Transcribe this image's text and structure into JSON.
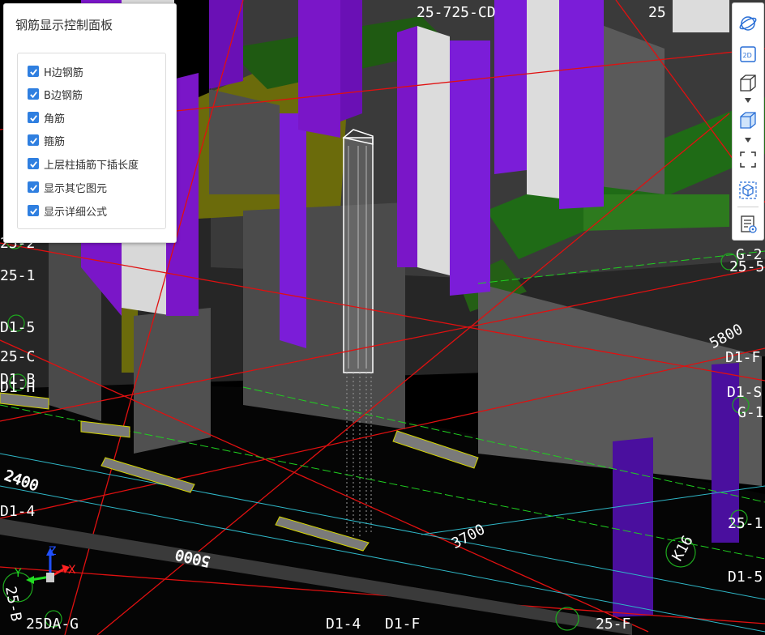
{
  "panel": {
    "title": "钢筋显示控制面板",
    "options": [
      {
        "label": "H边钢筋",
        "checked": true
      },
      {
        "label": "B边钢筋",
        "checked": true
      },
      {
        "label": "角筋",
        "checked": true
      },
      {
        "label": "箍筋",
        "checked": true
      },
      {
        "label": "上层柱插筋下插长度",
        "checked": true
      },
      {
        "label": "显示其它图元",
        "checked": true
      },
      {
        "label": "显示详细公式",
        "checked": true
      }
    ]
  },
  "toolbar": {
    "buttons": [
      {
        "icon": "orbit-icon"
      },
      {
        "icon": "view-2d-icon",
        "text": "2D"
      },
      {
        "icon": "cube-wireframe-icon"
      },
      {
        "icon": "cube-solid-icon"
      },
      {
        "icon": "fit-view-icon"
      },
      {
        "icon": "cube-select-icon"
      },
      {
        "icon": "report-icon"
      }
    ]
  },
  "scene": {
    "axis_labels": {
      "top_center": "25-725-CD",
      "top_right": "25",
      "left_1": "25-2",
      "left_2": "25-1",
      "left_3": "D1-5",
      "left_4": "25-C",
      "left_5": "D1-B",
      "left_6": "D1-H",
      "left_7": "D1-4",
      "right_1": "G-2",
      "right_2": "25-5",
      "right_3": "D1-F",
      "right_4": "D1-S",
      "right_5": "G-1",
      "right_6": "25-1",
      "right_7": "D1-5",
      "bottom_1": "25DA-G",
      "bottom_2": "D1-4",
      "bottom_3": "D1-F",
      "bottom_4": "25-F",
      "bottom_ring": "25-B",
      "bottom_ring2": "K16"
    },
    "dimensions": {
      "dim_5800": "5800",
      "dim_3700": "3700",
      "dim_5000": "5000",
      "dim_2400": "2400"
    },
    "gizmo": {
      "x": "X",
      "y": "Y",
      "z": "Z"
    }
  }
}
